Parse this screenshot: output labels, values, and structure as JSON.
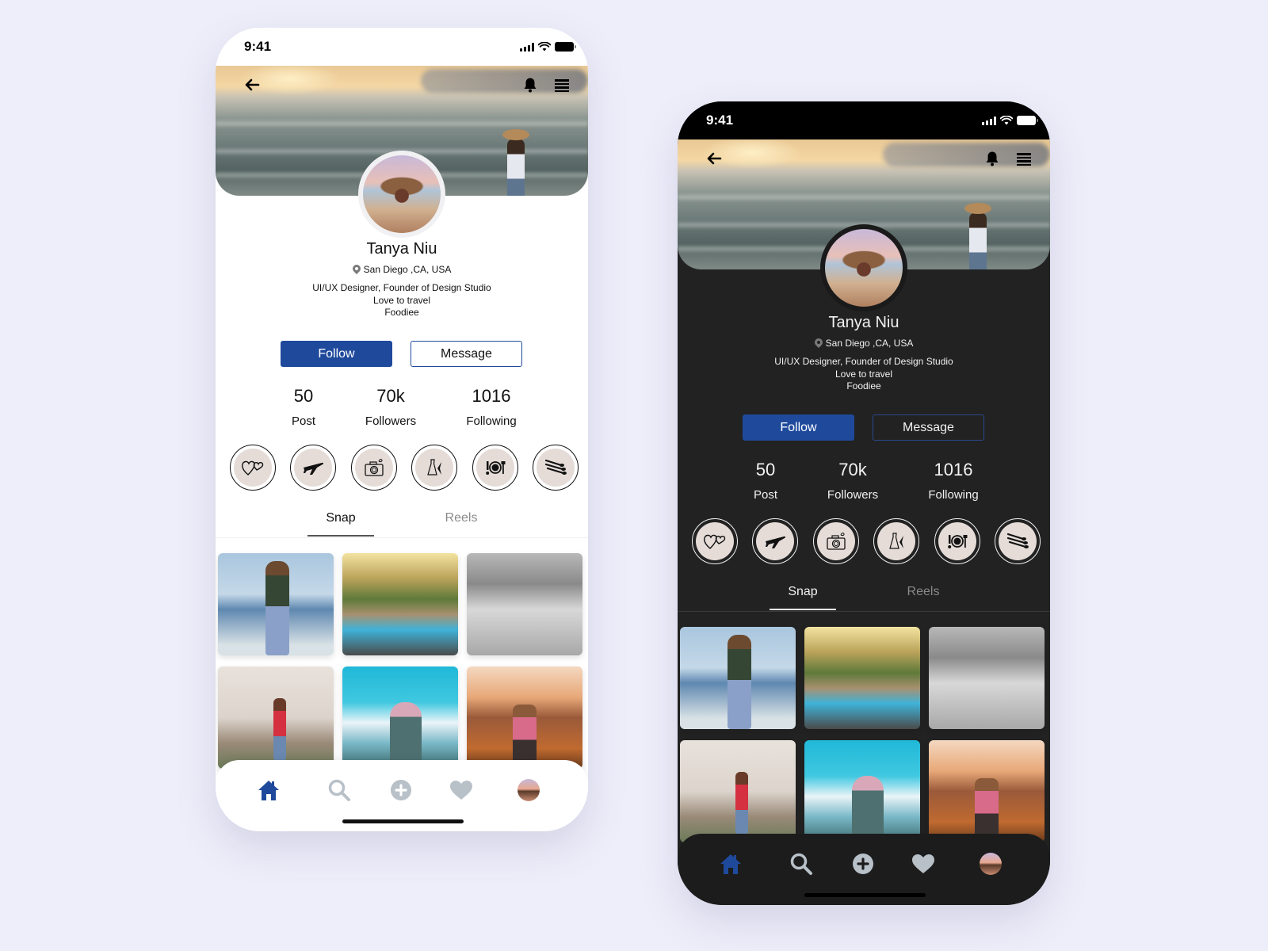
{
  "colors": {
    "accent": "#1f4a9c",
    "inactive_icon": "#b8c0c8",
    "page_bg": "#eeeefa"
  },
  "phones": [
    {
      "theme": "light",
      "status_bar": {
        "time": "9:41"
      },
      "header": {
        "back_icon": "arrow-left-icon",
        "bell_icon": "bell-icon",
        "menu_icon": "menu-icon"
      },
      "profile": {
        "name": "Tanya Niu",
        "location": "San Diego ,CA, USA",
        "bio": [
          "UI/UX Designer, Founder of Design Studio",
          "Love to travel",
          "Foodiee"
        ]
      },
      "buttons": {
        "follow": "Follow",
        "message": "Message"
      },
      "stats": [
        {
          "value": "50",
          "label": "Post"
        },
        {
          "value": "70k",
          "label": "Followers"
        },
        {
          "value": "1016",
          "label": "Following"
        }
      ],
      "highlights": [
        {
          "icon": "hearts-icon",
          "glyph": "♡"
        },
        {
          "icon": "airplane-icon",
          "glyph": "✈"
        },
        {
          "icon": "camera-icon",
          "glyph": "📷"
        },
        {
          "icon": "dress-icon",
          "glyph": "👗"
        },
        {
          "icon": "dining-icon",
          "glyph": "🍽"
        },
        {
          "icon": "makeup-brushes-icon",
          "glyph": "⫽"
        }
      ],
      "tabs": [
        {
          "label": "Snap",
          "active": true
        },
        {
          "label": "Reels",
          "active": false
        }
      ],
      "photos": [
        "woman-on-beach",
        "poolside-party",
        "bw-woman-by-pool",
        "woman-on-hill",
        "snowy-mountain-follow-me",
        "couple-at-sunset"
      ],
      "bottom_nav": [
        "home-icon",
        "search-icon",
        "add-icon",
        "heart-icon",
        "profile-avatar"
      ]
    },
    {
      "theme": "dark",
      "status_bar": {
        "time": "9:41"
      },
      "header": {
        "back_icon": "arrow-left-icon",
        "bell_icon": "bell-icon",
        "menu_icon": "menu-icon"
      },
      "profile": {
        "name": "Tanya Niu",
        "location": "San Diego ,CA, USA",
        "bio": [
          "UI/UX Designer, Founder of Design Studio",
          "Love to travel",
          "Foodiee"
        ]
      },
      "buttons": {
        "follow": "Follow",
        "message": "Message"
      },
      "stats": [
        {
          "value": "50",
          "label": "Post"
        },
        {
          "value": "70k",
          "label": "Followers"
        },
        {
          "value": "1016",
          "label": "Following"
        }
      ],
      "highlights": [
        {
          "icon": "hearts-icon",
          "glyph": "♡"
        },
        {
          "icon": "airplane-icon",
          "glyph": "✈"
        },
        {
          "icon": "camera-icon",
          "glyph": "📷"
        },
        {
          "icon": "dress-icon",
          "glyph": "👗"
        },
        {
          "icon": "dining-icon",
          "glyph": "🍽"
        },
        {
          "icon": "makeup-brushes-icon",
          "glyph": "⫽"
        }
      ],
      "tabs": [
        {
          "label": "Snap",
          "active": true
        },
        {
          "label": "Reels",
          "active": false
        }
      ],
      "photos": [
        "woman-on-beach",
        "poolside-party",
        "bw-woman-by-pool",
        "woman-on-hill",
        "snowy-mountain-follow-me",
        "couple-at-sunset"
      ],
      "bottom_nav": [
        "home-icon",
        "search-icon",
        "add-icon",
        "heart-icon",
        "profile-avatar"
      ]
    }
  ]
}
